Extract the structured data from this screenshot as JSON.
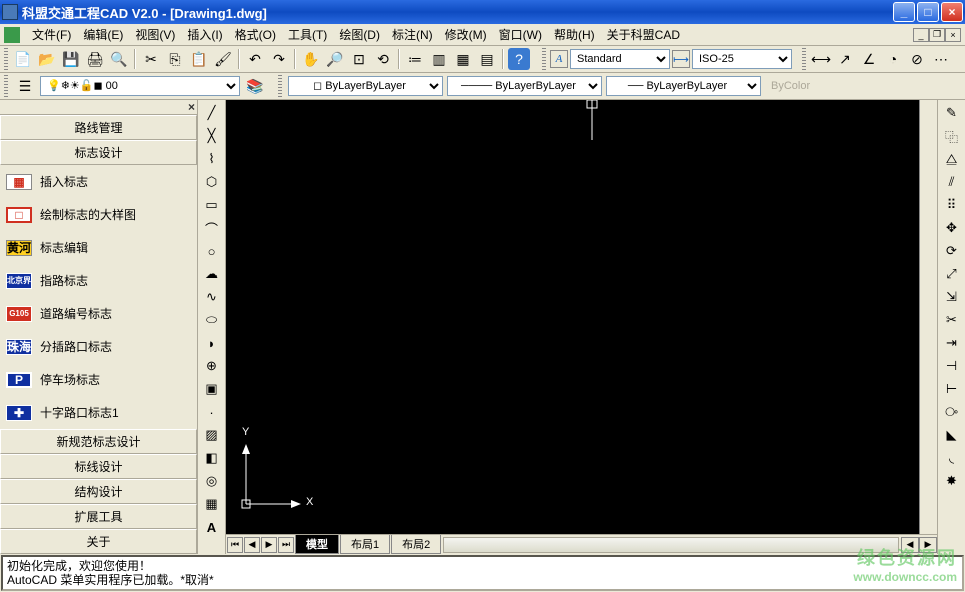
{
  "title": "科盟交通工程CAD V2.0 - [Drawing1.dwg]",
  "menus": [
    "文件(F)",
    "编辑(E)",
    "视图(V)",
    "插入(I)",
    "格式(O)",
    "工具(T)",
    "绘图(D)",
    "标注(N)",
    "修改(M)",
    "窗口(W)",
    "帮助(H)",
    "关于科盟CAD"
  ],
  "style_bar": {
    "text_style": "Standard",
    "dim_style": "ISO-25"
  },
  "layer_bar": {
    "current": "0"
  },
  "props": {
    "color": "ByLayer",
    "linetype": "ByLayer",
    "lineweight": "ByLayer",
    "plotstyle": "ByColor"
  },
  "left_panel": {
    "close": "×",
    "top_btns": [
      "路线管理",
      "标志设计"
    ],
    "items": [
      {
        "icon_bg": "#ffffff",
        "icon_border": "1px solid #888",
        "icon_text": "▦",
        "icon_color": "#d03020",
        "label": "插入标志"
      },
      {
        "icon_bg": "#ffffff",
        "icon_border": "2px solid #d03020",
        "icon_text": "□",
        "icon_color": "#d03020",
        "label": "绘制标志的大样图"
      },
      {
        "icon_bg": "#ffd020",
        "icon_border": "1px solid #888",
        "icon_text": "黄河",
        "icon_color": "#000",
        "label": "标志编辑"
      },
      {
        "icon_bg": "#1030a0",
        "icon_border": "1px solid #fff",
        "icon_text": "北京界",
        "icon_color": "#fff",
        "label": "指路标志"
      },
      {
        "icon_bg": "#d03020",
        "icon_border": "1px solid #fff",
        "icon_text": "G105",
        "icon_color": "#fff",
        "label": "道路编号标志"
      },
      {
        "icon_bg": "#1030a0",
        "icon_border": "1px solid #fff",
        "icon_text": "珠海",
        "icon_color": "#fff",
        "label": "分插路口标志"
      },
      {
        "icon_bg": "#1030a0",
        "icon_border": "2px solid #fff",
        "icon_text": "P",
        "icon_color": "#fff",
        "label": "停车场标志"
      },
      {
        "icon_bg": "#1030a0",
        "icon_border": "1px solid #fff",
        "icon_text": "✚",
        "icon_color": "#fff",
        "label": "十字路口标志1"
      }
    ],
    "bottom_btns": [
      "新规范标志设计",
      "标线设计",
      "结构设计",
      "扩展工具",
      "关于"
    ]
  },
  "ucs": {
    "x": "X",
    "y": "Y"
  },
  "tabs": {
    "active": "模型",
    "others": [
      "布局1",
      "布局2"
    ]
  },
  "cmdline": "初始化完成，欢迎您使用！\nAutoCAD 菜单实用程序已加载。*取消*",
  "watermark": {
    "l1": "绿色资源网",
    "l2": "www.downcc.com"
  },
  "std_icons": [
    "new",
    "open",
    "save",
    "print",
    "preview",
    "|",
    "cut",
    "copy",
    "paste",
    "match",
    "|",
    "undo",
    "redo",
    "|",
    "pan",
    "zoomrt",
    "zoomext",
    "zoom",
    "|",
    "prop",
    "dc",
    "tp",
    "calc",
    "|",
    "help"
  ],
  "draw_icons": [
    "line",
    "cline",
    "pline",
    "polygon",
    "rect",
    "arc",
    "circle",
    "revcloud",
    "spline",
    "ellipse",
    "ellipsearc",
    "insert",
    "block",
    "point",
    "hatch",
    "gradient",
    "region",
    "table",
    "mtext"
  ],
  "mod_icons": [
    "erase",
    "copy",
    "mirror",
    "offset",
    "array",
    "move",
    "rotate",
    "scale",
    "stretch",
    "trim",
    "extend",
    "break",
    "break2",
    "join",
    "chamfer",
    "fillet",
    "explode"
  ],
  "right_icons": [
    "dist",
    "area",
    "|",
    "osnap",
    "|",
    "ucs",
    "|",
    "pan",
    "zoom",
    "zoomw",
    "zoomp",
    "|",
    "3dorbit",
    "|",
    "view",
    "|",
    "paint"
  ]
}
